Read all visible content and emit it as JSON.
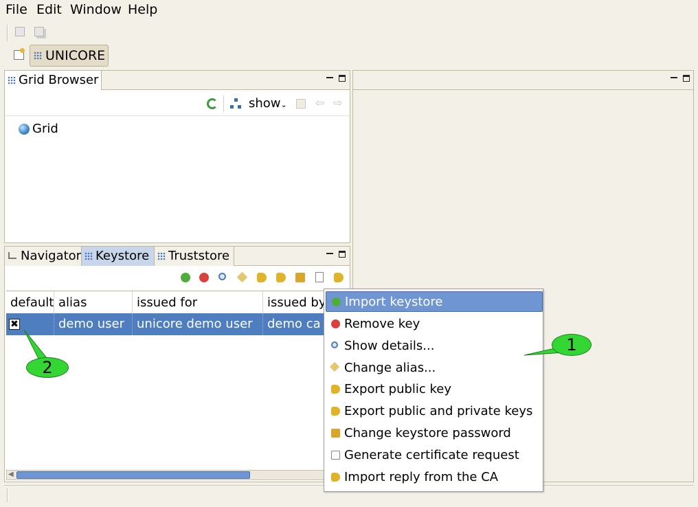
{
  "menubar": {
    "file": "File",
    "edit": "Edit",
    "window": "Window",
    "help": "Help"
  },
  "toolbar": {
    "icons": [
      "save-icon",
      "save-all-icon"
    ]
  },
  "perspective": {
    "label": "UNICORE"
  },
  "grid_browser": {
    "tab_label": "Grid Browser",
    "show_label": "show",
    "tree": [
      {
        "label": "Grid"
      }
    ]
  },
  "bottom_panel": {
    "tabs": [
      {
        "label": "Navigator"
      },
      {
        "label": "Keystore"
      },
      {
        "label": "Truststore"
      }
    ],
    "columns": [
      "default",
      "alias",
      "issued for",
      "issued by"
    ],
    "rows": [
      {
        "default": true,
        "alias": "demo user",
        "issued_for": "unicore demo user",
        "issued_by": "demo ca"
      }
    ]
  },
  "context_menu": {
    "items": [
      {
        "label": "Import keystore",
        "icon": "plus-circle-icon",
        "highlighted": true
      },
      {
        "label": "Remove key",
        "icon": "minus-circle-icon"
      },
      {
        "label": "Show details...",
        "icon": "magnifier-icon"
      },
      {
        "label": "Change alias...",
        "icon": "tag-icon"
      },
      {
        "label": "Export public key",
        "icon": "key-export-icon"
      },
      {
        "label": "Export public and private keys",
        "icon": "keys-export-icon"
      },
      {
        "label": "Change keystore password",
        "icon": "lock-icon"
      },
      {
        "label": "Generate certificate request",
        "icon": "document-icon"
      },
      {
        "label": "Import reply from the CA",
        "icon": "key-import-icon"
      }
    ]
  },
  "callouts": [
    "1",
    "2"
  ],
  "colors": {
    "selection": "#4f7ec0",
    "menu_highlight": "#6f96d2",
    "callout": "#33d633"
  }
}
